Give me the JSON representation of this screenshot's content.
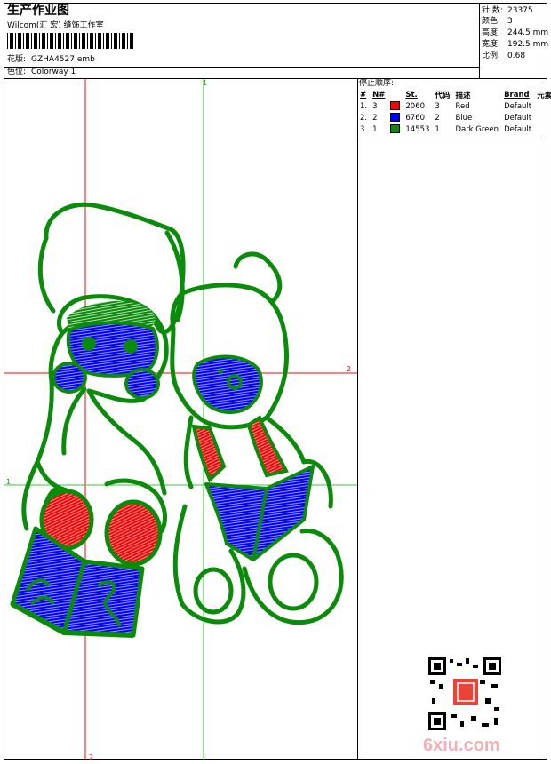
{
  "header": {
    "title": "生产作业图",
    "company": "Wilcom(汇 宏) 缝饰工作室",
    "design_label": "花版:",
    "design_value": "GZHA4527.emb",
    "colorway_label": "色位:",
    "colorway_value": "Colorway 1"
  },
  "stats": [
    {
      "label": "针 数:",
      "value": "23375"
    },
    {
      "label": "颜色:",
      "value": "3"
    },
    {
      "label": "高度:",
      "value": "244.5 mm"
    },
    {
      "label": "宽度:",
      "value": "192.5 mm"
    },
    {
      "label": "比例:",
      "value": "0.68"
    }
  ],
  "stop_sequence": {
    "title": "停止顺序:",
    "columns": [
      "#",
      "N#",
      "St.",
      "代码",
      "描述",
      "Brand",
      "元素"
    ],
    "rows": [
      {
        "num": "1.",
        "n": "3",
        "color": "#ff0000",
        "st": "2060",
        "code": "3",
        "desc": "Red",
        "brand": "Default"
      },
      {
        "num": "2.",
        "n": "2",
        "color": "#0000ff",
        "st": "6760",
        "code": "2",
        "desc": "Blue",
        "brand": "Default"
      },
      {
        "num": "3.",
        "n": "1",
        "color": "#0a8c0a",
        "st": "14553",
        "code": "1",
        "desc": "Dark Green",
        "brand": "Default"
      }
    ]
  },
  "guides": {
    "top": "1",
    "right": "2",
    "left": "1",
    "bottom": "2"
  },
  "colors": {
    "red": "#ff0000",
    "blue": "#0000ff",
    "green": "#0a8c0a",
    "guide_red": "#ff0000",
    "guide_green": "#33cc33"
  },
  "watermark": "6xiu.com"
}
